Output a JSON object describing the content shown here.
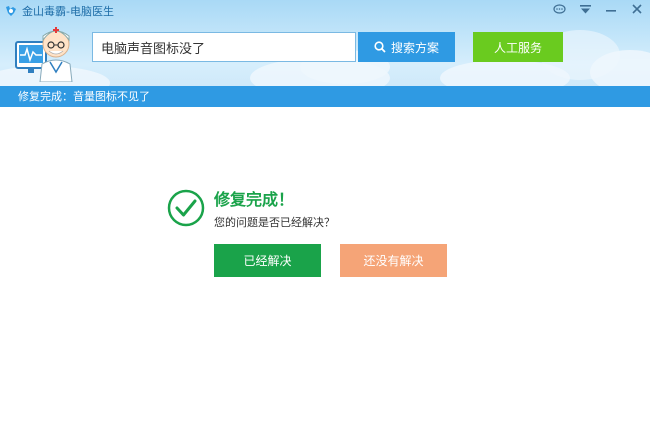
{
  "window": {
    "title": "金山毒霸-电脑医生",
    "controls": [
      "chat-icon",
      "menu-icon",
      "minimize-icon",
      "close-icon"
    ]
  },
  "search": {
    "value": "电脑声音图标没了",
    "button_label": "搜索方案"
  },
  "service": {
    "button_label": "人工服务"
  },
  "status": {
    "text": "修复完成：音量图标不见了"
  },
  "result": {
    "title": "修复完成！",
    "question": "您的问题是否已经解决？",
    "solved_label": "已经解决",
    "unsolved_label": "还没有解决"
  },
  "colors": {
    "accent_blue": "#2f9ae3",
    "success_green": "#1aa34a",
    "service_green": "#6acb1f",
    "unsolved_orange": "#f5a477"
  }
}
